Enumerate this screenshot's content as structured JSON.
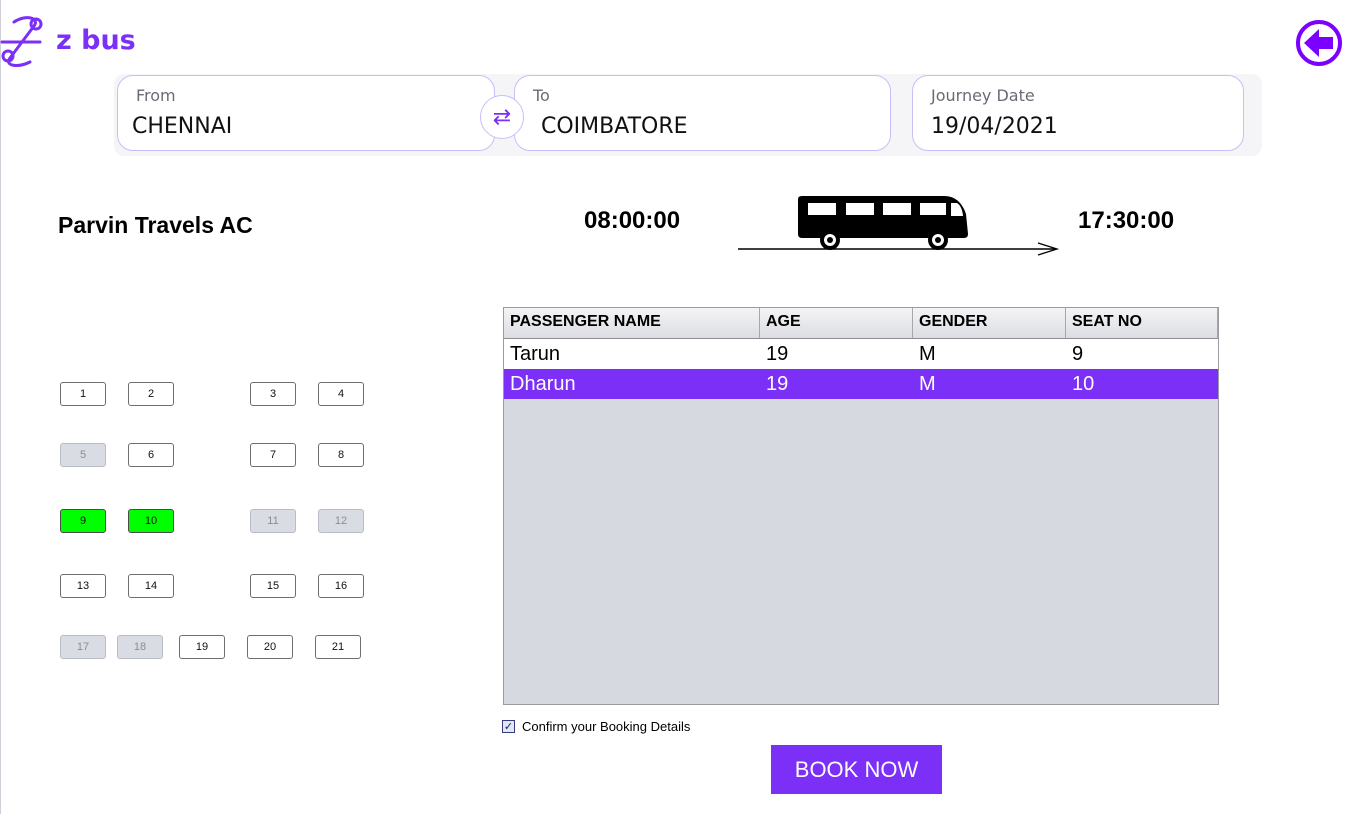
{
  "brand": {
    "name": "z bus",
    "color": "#7b2ff7"
  },
  "icons": {
    "logo": "brand-logo-icon",
    "back": "back-arrow-icon",
    "swap": "swap-arrows-icon",
    "bus": "bus-icon",
    "check": "checkbox-checked-icon"
  },
  "search": {
    "from": {
      "label": "From",
      "value": "CHENNAI"
    },
    "to": {
      "label": "To",
      "value": "COIMBATORE"
    },
    "date": {
      "label": "Journey Date",
      "value": "19/04/2021"
    },
    "swap_glyph": "⇄"
  },
  "trip": {
    "operator": "Parvin Travels AC",
    "departure": "08:00:00",
    "arrival": "17:30:00"
  },
  "seats": [
    {
      "no": "1",
      "state": "available"
    },
    {
      "no": "2",
      "state": "available"
    },
    {
      "no": "3",
      "state": "available"
    },
    {
      "no": "4",
      "state": "available"
    },
    {
      "no": "5",
      "state": "booked"
    },
    {
      "no": "6",
      "state": "available"
    },
    {
      "no": "7",
      "state": "available"
    },
    {
      "no": "8",
      "state": "available"
    },
    {
      "no": "9",
      "state": "selected"
    },
    {
      "no": "10",
      "state": "selected"
    },
    {
      "no": "11",
      "state": "booked"
    },
    {
      "no": "12",
      "state": "booked"
    },
    {
      "no": "13",
      "state": "available"
    },
    {
      "no": "14",
      "state": "available"
    },
    {
      "no": "15",
      "state": "available"
    },
    {
      "no": "16",
      "state": "available"
    },
    {
      "no": "17",
      "state": "booked"
    },
    {
      "no": "18",
      "state": "booked"
    },
    {
      "no": "19",
      "state": "available"
    },
    {
      "no": "20",
      "state": "available"
    },
    {
      "no": "21",
      "state": "available"
    }
  ],
  "seat_colors": {
    "selected": "#00ff00",
    "booked": "#d9dce3",
    "available": "#ffffff"
  },
  "table": {
    "columns": [
      "PASSENGER NAME",
      "AGE",
      "GENDER",
      "SEAT NO"
    ],
    "rows": [
      {
        "name": "Tarun",
        "age": "19",
        "gender": "M",
        "seat": "9",
        "selected": false
      },
      {
        "name": "Dharun",
        "age": "19",
        "gender": "M",
        "seat": "10",
        "selected": true
      }
    ],
    "selection_color": "#7b2ff7"
  },
  "confirm": {
    "label": "Confirm your Booking Details",
    "checked": true
  },
  "book_button": {
    "label": "BOOK NOW"
  }
}
